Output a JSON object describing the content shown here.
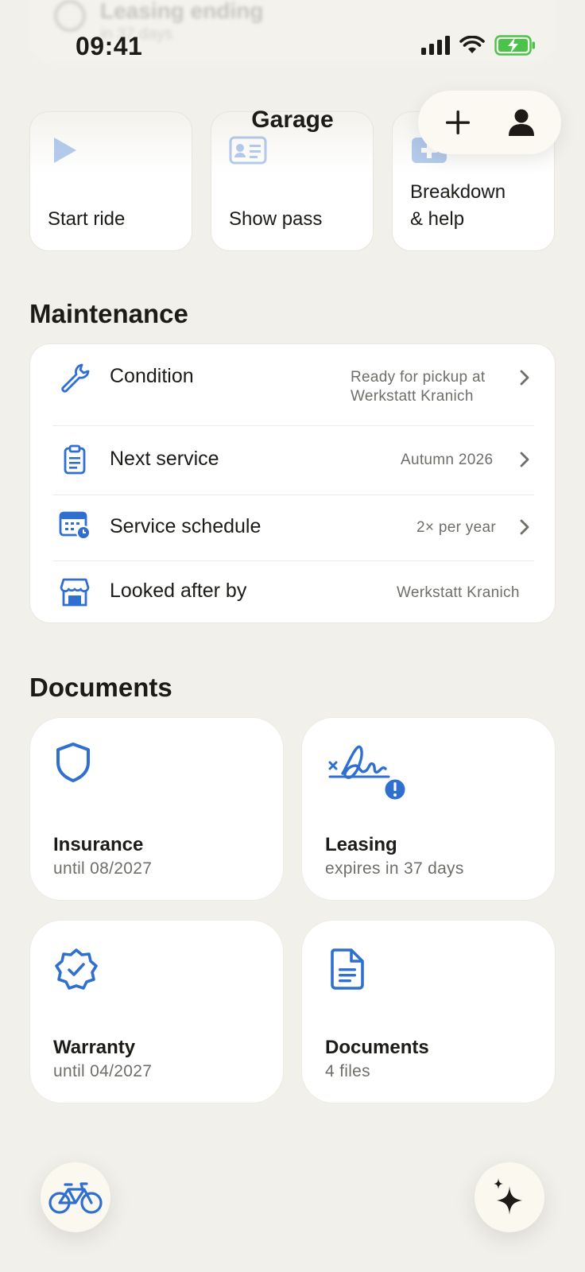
{
  "colors": {
    "accent": "#2f6fd0",
    "background": "#f1f0ea",
    "card": "#ffffff",
    "text": "#1c1b18",
    "muted": "#6f6e69",
    "battery": "#4cc24a"
  },
  "status_bar": {
    "time": "09:41",
    "icons": [
      "cellular-icon",
      "wifi-icon",
      "battery-charging-icon"
    ]
  },
  "background_banner": {
    "title": "Leasing ending",
    "subtitle": "in 37 days"
  },
  "header": {
    "title": "Garage",
    "actions": [
      "add-icon",
      "profile-icon"
    ]
  },
  "quick_actions": [
    {
      "label": "Start ride",
      "icon": "play-icon"
    },
    {
      "label": "Show pass",
      "icon": "id-card-icon"
    },
    {
      "label": "Breakdown\n& help",
      "icon": "first-aid-icon"
    }
  ],
  "maintenance": {
    "title": "Maintenance",
    "rows": [
      {
        "label": "Condition",
        "value": "Ready for pickup at\nWerkstatt Kranich",
        "icon": "wrench-icon",
        "chevron": true
      },
      {
        "label": "Next service",
        "value": "Autumn 2026",
        "icon": "clipboard-icon",
        "chevron": true
      },
      {
        "label": "Service schedule",
        "value": "2× per year",
        "icon": "calendar-clock-icon",
        "chevron": true
      },
      {
        "label": "Looked after by",
        "value": "Werkstatt Kranich",
        "icon": "store-icon",
        "chevron": false
      }
    ]
  },
  "documents": {
    "title": "Documents",
    "cards": [
      {
        "title": "Insurance",
        "subtitle": "until 08/2027",
        "icon": "shield-icon"
      },
      {
        "title": "Leasing",
        "subtitle": "expires in 37 days",
        "icon": "signature-alert-icon"
      },
      {
        "title": "Warranty",
        "subtitle": "until 04/2027",
        "icon": "verified-badge-icon"
      },
      {
        "title": "Documents",
        "subtitle": "4 files",
        "icon": "document-icon"
      }
    ]
  },
  "bottom_bar": {
    "left_icon": "bicycle-icon",
    "right_icon": "sparkles-icon"
  }
}
